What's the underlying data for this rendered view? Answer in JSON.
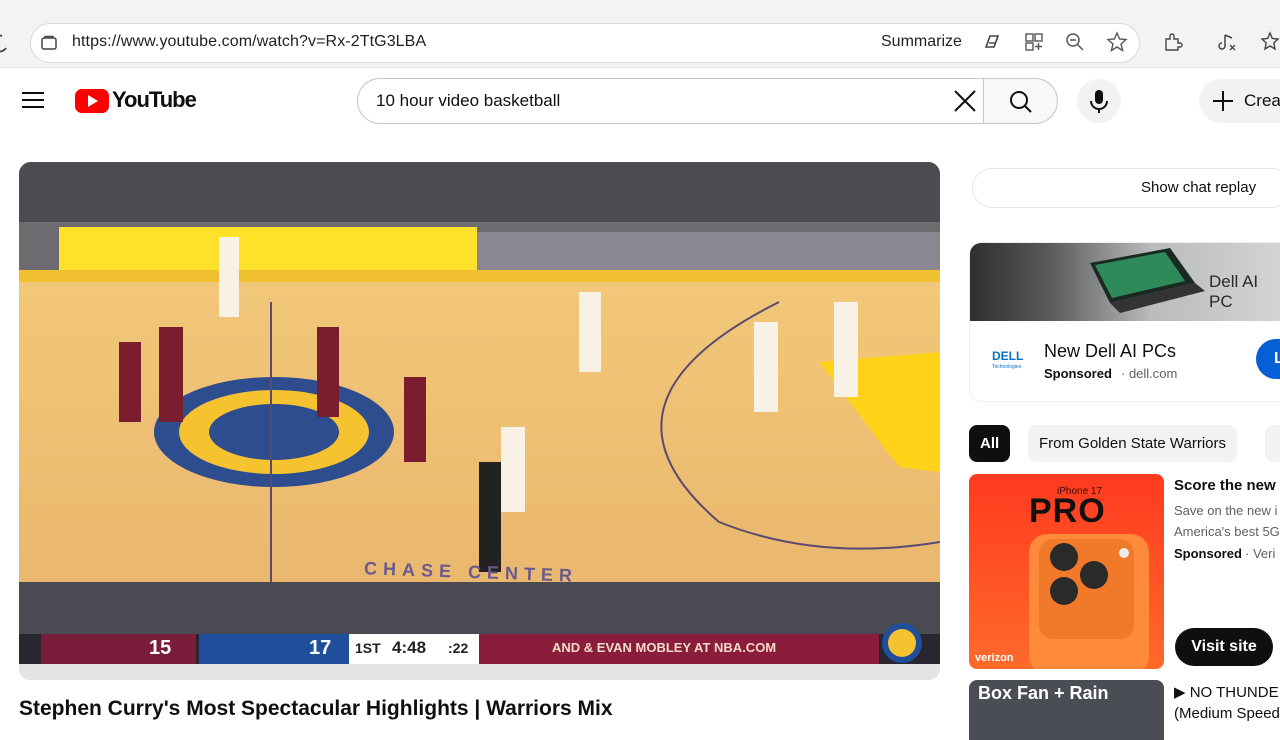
{
  "browser": {
    "url": "https://www.youtube.com/watch?v=Rx-2TtG3LBA",
    "summarize_label": "Summarize"
  },
  "header": {
    "logo_text": "YouTube",
    "search_query": "10 hour video basketball",
    "create_label": "Creat"
  },
  "video": {
    "title": "Stephen Curry's Most Spectacular Highlights | Warriors Mix",
    "scoreboard": {
      "away_score": "15",
      "home_score": "17",
      "quarter": "1ST",
      "clock": "4:48",
      "shot_clock": ":22",
      "ticker": "AND & EVAN MOBLEY AT NBA.COM"
    },
    "arena_text": "CHASE CENTER"
  },
  "sidebar": {
    "chat_replay_label": "Show chat replay",
    "ad": {
      "banner_text": "Dell AI PC",
      "title": "New Dell AI PCs",
      "sponsored": "Sponsored",
      "domain": "· dell.com",
      "cta": "L"
    },
    "chips": [
      "All",
      "From Golden State Warriors"
    ],
    "rec1": {
      "title": "Score the new",
      "desc1": "Save on the new i",
      "desc2": "America's best 5G",
      "sponsored": "Sponsored",
      "domain": "· Veri",
      "cta": "Visit site",
      "thumb_top": "iPhone 17",
      "thumb_big": "PRO",
      "thumb_brand": "verizon"
    },
    "rec2": {
      "thumb_text": "Box Fan + Rain",
      "title": "▶ NO THUNDE",
      "subtitle": "(Medium Speed"
    }
  },
  "colors": {
    "youtube_red": "#ff0000",
    "chip_active": "#0f0f0f",
    "dell_blue": "#065fd4",
    "verizon_orange": "#ff4a1f"
  }
}
